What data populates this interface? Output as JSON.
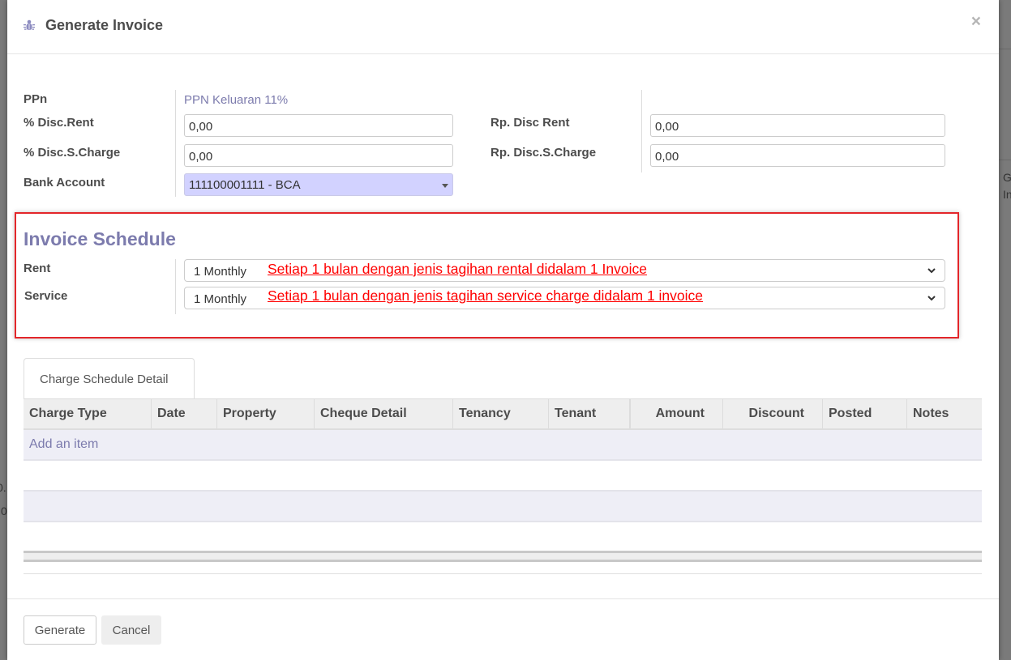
{
  "background": {
    "fragments_right": [
      "G",
      "In"
    ],
    "fragments_left": [
      "0.",
      "0"
    ]
  },
  "modal": {
    "title": "Generate Invoice",
    "title_icon": "bug-icon",
    "close_label": "×"
  },
  "form": {
    "ppn": {
      "label": "PPn",
      "value": "PPN Keluaran 11%"
    },
    "disc_rent_pct": {
      "label": "% Disc.Rent",
      "value": "0,00"
    },
    "disc_scharge_pct": {
      "label": "% Disc.S.Charge",
      "value": "0,00"
    },
    "bank_account": {
      "label": "Bank Account",
      "value": "111100001111 - BCA"
    },
    "disc_rent_rp": {
      "label": "Rp. Disc Rent",
      "value": "0,00"
    },
    "disc_scharge_rp": {
      "label": "Rp. Disc.S.Charge",
      "value": "0,00"
    }
  },
  "invoice_schedule": {
    "title": "Invoice Schedule",
    "rent": {
      "label": "Rent",
      "value": "1 Monthly",
      "annotation": "Setiap 1 bulan dengan jenis tagihan rental didalam 1 Invoice"
    },
    "service": {
      "label": "Service",
      "value": "1 Monthly",
      "annotation": "Setiap 1 bulan dengan jenis tagihan service charge didalam 1 invoice"
    },
    "annotation_color": "#ff0000"
  },
  "tabs": [
    {
      "label": "Charge Schedule Detail",
      "active": true
    }
  ],
  "table": {
    "columns": [
      "Charge Type",
      "Date",
      "Property",
      "Cheque Detail",
      "Tenancy",
      "Tenant",
      "Amount",
      "Discount",
      "Posted",
      "Notes"
    ],
    "add_item_label": "Add an item",
    "rows": []
  },
  "footer": {
    "generate_label": "Generate",
    "cancel_label": "Cancel"
  },
  "colors": {
    "accent": "#7c7bad",
    "highlight_border": "#e3262a",
    "bank_select_bg": "#d2d2ff"
  }
}
